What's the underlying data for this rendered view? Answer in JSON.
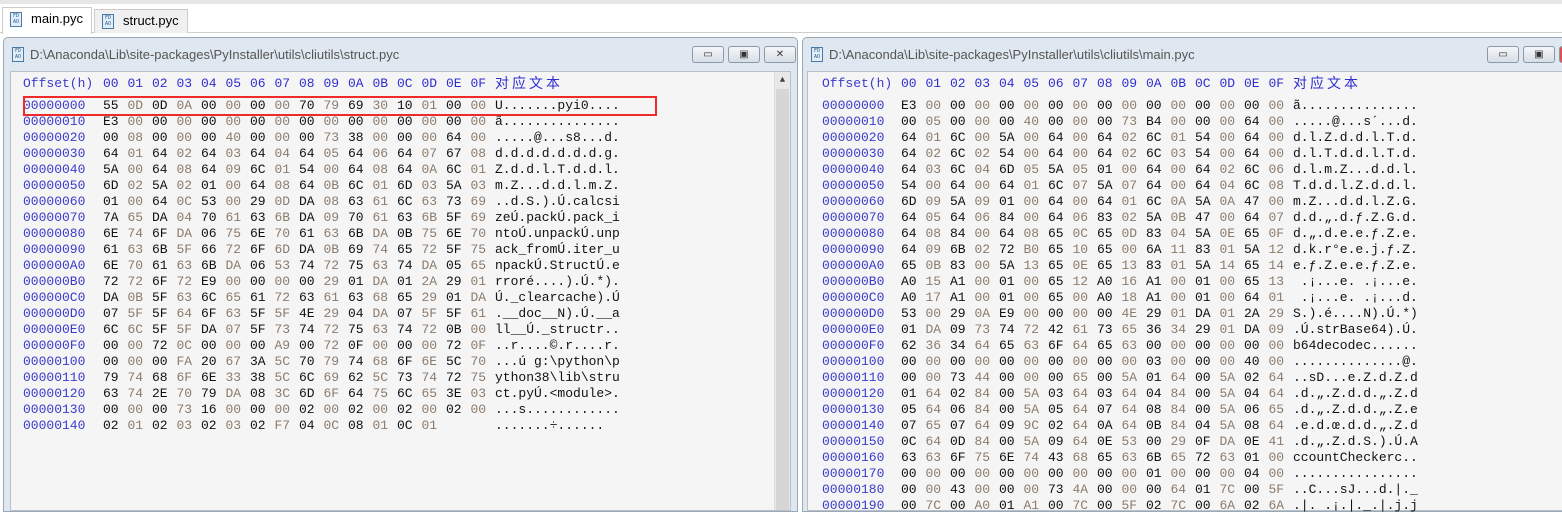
{
  "tabs": [
    {
      "label": "main.pyc",
      "active": true
    },
    {
      "label": "struct.pyc",
      "active": false
    }
  ],
  "header": {
    "offset_label": "Offset(h)",
    "columns": [
      "00",
      "01",
      "02",
      "03",
      "04",
      "05",
      "06",
      "07",
      "08",
      "09",
      "0A",
      "0B",
      "0C",
      "0D",
      "0E",
      "0F"
    ],
    "text_label": "对应文本"
  },
  "icon_text": "FD AO",
  "window_buttons": {
    "minimize": "▭",
    "maximize": "▣",
    "close": "✕"
  },
  "left": {
    "title": "D:\\Anaconda\\Lib\\site-packages\\PyInstaller\\utils\\cliutils\\struct.pyc",
    "highlight_row": 0,
    "rows": [
      {
        "offset": "00000000",
        "hex": "55 0D 0D 0A 00 00 00 00 70 79 69 30 10 01 00 00",
        "text": "U.......pyi0...."
      },
      {
        "offset": "00000010",
        "hex": "E3 00 00 00 00 00 00 00 00 00 00 00 00 00 00 00",
        "text": "ã..............."
      },
      {
        "offset": "00000020",
        "hex": "00 08 00 00 00 40 00 00 00 73 38 00 00 00 64 00",
        "text": ".....@...s8...d."
      },
      {
        "offset": "00000030",
        "hex": "64 01 64 02 64 03 64 04 64 05 64 06 64 07 67 08",
        "text": "d.d.d.d.d.d.d.g."
      },
      {
        "offset": "00000040",
        "hex": "5A 00 64 08 64 09 6C 01 54 00 64 08 64 0A 6C 01",
        "text": "Z.d.d.l.T.d.d.l."
      },
      {
        "offset": "00000050",
        "hex": "6D 02 5A 02 01 00 64 08 64 0B 6C 01 6D 03 5A 03",
        "text": "m.Z...d.d.l.m.Z."
      },
      {
        "offset": "00000060",
        "hex": "01 00 64 0C 53 00 29 0D DA 08 63 61 6C 63 73 69",
        "text": "..d.S.).Ú.calcsi"
      },
      {
        "offset": "00000070",
        "hex": "7A 65 DA 04 70 61 63 6B DA 09 70 61 63 6B 5F 69",
        "text": "zeÚ.packÚ.pack_i"
      },
      {
        "offset": "00000080",
        "hex": "6E 74 6F DA 06 75 6E 70 61 63 6B DA 0B 75 6E 70",
        "text": "ntoÚ.unpackÚ.unp"
      },
      {
        "offset": "00000090",
        "hex": "61 63 6B 5F 66 72 6F 6D DA 0B 69 74 65 72 5F 75",
        "text": "ack_fromÚ.iter_u"
      },
      {
        "offset": "000000A0",
        "hex": "6E 70 61 63 6B DA 06 53 74 72 75 63 74 DA 05 65",
        "text": "npackÚ.StructÚ.e"
      },
      {
        "offset": "000000B0",
        "hex": "72 72 6F 72 E9 00 00 00 00 29 01 DA 01 2A 29 01",
        "text": "rroré....).Ú.*)."
      },
      {
        "offset": "000000C0",
        "hex": "DA 0B 5F 63 6C 65 61 72 63 61 63 68 65 29 01 DA",
        "text": "Ú._clearcache).Ú"
      },
      {
        "offset": "000000D0",
        "hex": "07 5F 5F 64 6F 63 5F 5F 4E 29 04 DA 07 5F 5F 61",
        "text": ".__doc__N).Ú.__a"
      },
      {
        "offset": "000000E0",
        "hex": "6C 6C 5F 5F DA 07 5F 73 74 72 75 63 74 72 0B 00",
        "text": "ll__Ú._structr.."
      },
      {
        "offset": "000000F0",
        "hex": "00 00 72 0C 00 00 00 A9 00 72 0F 00 00 00 72 0F",
        "text": "..r....©.r....r."
      },
      {
        "offset": "00000100",
        "hex": "00 00 00 FA 20 67 3A 5C 70 79 74 68 6F 6E 5C 70",
        "text": "...ú g:\\python\\p"
      },
      {
        "offset": "00000110",
        "hex": "79 74 68 6F 6E 33 38 5C 6C 69 62 5C 73 74 72 75",
        "text": "ython38\\lib\\stru"
      },
      {
        "offset": "00000120",
        "hex": "63 74 2E 70 79 DA 08 3C 6D 6F 64 75 6C 65 3E 03",
        "text": "ct.pyÚ.<module>."
      },
      {
        "offset": "00000130",
        "hex": "00 00 00 73 16 00 00 00 02 00 02 00 02 00 02 00",
        "text": "...s............"
      },
      {
        "offset": "00000140",
        "hex": "02 01 02 03 02 03 02 F7 04 0C 08 01 0C 01",
        "text": ".......÷......"
      }
    ]
  },
  "right": {
    "title": "D:\\Anaconda\\Lib\\site-packages\\PyInstaller\\utils\\cliutils\\main.pyc",
    "rows": [
      {
        "offset": "00000000",
        "hex": "E3 00 00 00 00 00 00 00 00 00 00 00 00 00 00 00",
        "text": "ã..............."
      },
      {
        "offset": "00000010",
        "hex": "00 05 00 00 00 40 00 00 00 73 B4 00 00 00 64 00",
        "text": ".....@...s´...d."
      },
      {
        "offset": "00000020",
        "hex": "64 01 6C 00 5A 00 64 00 64 02 6C 01 54 00 64 00",
        "text": "d.l.Z.d.d.l.T.d."
      },
      {
        "offset": "00000030",
        "hex": "64 02 6C 02 54 00 64 00 64 02 6C 03 54 00 64 00",
        "text": "d.l.T.d.d.l.T.d."
      },
      {
        "offset": "00000040",
        "hex": "64 03 6C 04 6D 05 5A 05 01 00 64 00 64 02 6C 06",
        "text": "d.l.m.Z...d.d.l."
      },
      {
        "offset": "00000050",
        "hex": "54 00 64 00 64 01 6C 07 5A 07 64 00 64 04 6C 08",
        "text": "T.d.d.l.Z.d.d.l."
      },
      {
        "offset": "00000060",
        "hex": "6D 09 5A 09 01 00 64 00 64 01 6C 0A 5A 0A 47 00",
        "text": "m.Z...d.d.l.Z.G."
      },
      {
        "offset": "00000070",
        "hex": "64 05 64 06 84 00 64 06 83 02 5A 0B 47 00 64 07",
        "text": "d.d.„.d.ƒ.Z.G.d."
      },
      {
        "offset": "00000080",
        "hex": "64 08 84 00 64 08 65 0C 65 0D 83 04 5A 0E 65 0F",
        "text": "d.„.d.e.e.ƒ.Z.e."
      },
      {
        "offset": "00000090",
        "hex": "64 09 6B 02 72 B0 65 10 65 00 6A 11 83 01 5A 12",
        "text": "d.k.r°e.e.j.ƒ.Z."
      },
      {
        "offset": "000000A0",
        "hex": "65 0B 83 00 5A 13 65 0E 65 13 83 01 5A 14 65 14",
        "text": "e.ƒ.Z.e.e.ƒ.Z.e."
      },
      {
        "offset": "000000B0",
        "hex": "A0 15 A1 00 01 00 65 12 A0 16 A1 00 01 00 65 13",
        "text": " .¡...e. .¡...e."
      },
      {
        "offset": "000000C0",
        "hex": "A0 17 A1 00 01 00 65 00 A0 18 A1 00 01 00 64 01",
        "text": " .¡...e. .¡...d."
      },
      {
        "offset": "000000D0",
        "hex": "53 00 29 0A E9 00 00 00 00 4E 29 01 DA 01 2A 29",
        "text": "S.).é....N).Ú.*)"
      },
      {
        "offset": "000000E0",
        "hex": "01 DA 09 73 74 72 42 61 73 65 36 34 29 01 DA 09",
        "text": ".Ú.strBase64).Ú."
      },
      {
        "offset": "000000F0",
        "hex": "62 36 34 64 65 63 6F 64 65 63 00 00 00 00 00 00",
        "text": "b64decodec......"
      },
      {
        "offset": "00000100",
        "hex": "00 00 00 00 00 00 00 00 00 00 03 00 00 00 40 00",
        "text": "..............@."
      },
      {
        "offset": "00000110",
        "hex": "00 00 73 44 00 00 00 65 00 5A 01 64 00 5A 02 64",
        "text": "..sD...e.Z.d.Z.d"
      },
      {
        "offset": "00000120",
        "hex": "01 64 02 84 00 5A 03 64 03 64 04 84 00 5A 04 64",
        "text": ".d.„.Z.d.d.„.Z.d"
      },
      {
        "offset": "00000130",
        "hex": "05 64 06 84 00 5A 05 64 07 64 08 84 00 5A 06 65",
        "text": ".d.„.Z.d.d.„.Z.e"
      },
      {
        "offset": "00000140",
        "hex": "07 65 07 64 09 9C 02 64 0A 64 0B 84 04 5A 08 64",
        "text": ".e.d.œ.d.d.„.Z.d"
      },
      {
        "offset": "00000150",
        "hex": "0C 64 0D 84 00 5A 09 64 0E 53 00 29 0F DA 0E 41",
        "text": ".d.„.Z.d.S.).Ú.A"
      },
      {
        "offset": "00000160",
        "hex": "63 63 6F 75 6E 74 43 68 65 63 6B 65 72 63 01 00",
        "text": "ccountCheckerc.."
      },
      {
        "offset": "00000170",
        "hex": "00 00 00 00 00 00 00 00 00 00 01 00 00 00 04 00",
        "text": "................"
      },
      {
        "offset": "00000180",
        "hex": "00 00 43 00 00 00 73 4A 00 00 00 64 01 7C 00 5F",
        "text": "..C...sJ...d.|._"
      },
      {
        "offset": "00000190",
        "hex": "00 7C 00 A0 01 A1 00 7C 00 5F 02 7C 00 6A 02 6A",
        "text": ".|. .¡.|._.|.j.j"
      }
    ]
  }
}
